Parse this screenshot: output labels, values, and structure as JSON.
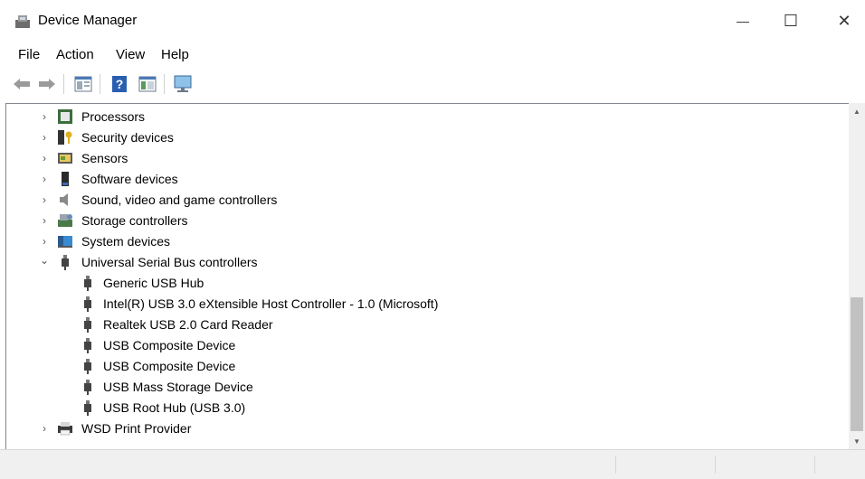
{
  "window": {
    "title": "Device Manager",
    "minimize_glyph": "—",
    "maximize_glyph": "☐",
    "close_glyph": "✕"
  },
  "menu": {
    "file": "File",
    "action": "Action",
    "view": "View",
    "help": "Help"
  },
  "toolbar": {
    "icons": [
      "back-arrow-icon",
      "forward-arrow-icon",
      "properties-icon",
      "help-icon",
      "view-icon",
      "monitor-scan-icon"
    ]
  },
  "tree": {
    "items": [
      {
        "label": "Processors",
        "expanded": false,
        "icon": "processor-icon"
      },
      {
        "label": "Security devices",
        "expanded": false,
        "icon": "security-key-icon"
      },
      {
        "label": "Sensors",
        "expanded": false,
        "icon": "sensor-icon"
      },
      {
        "label": "Software devices",
        "expanded": false,
        "icon": "software-device-icon"
      },
      {
        "label": "Sound, video and game controllers",
        "expanded": false,
        "icon": "speaker-icon"
      },
      {
        "label": "Storage controllers",
        "expanded": false,
        "icon": "storage-controller-icon"
      },
      {
        "label": "System devices",
        "expanded": false,
        "icon": "system-device-icon"
      },
      {
        "label": "Universal Serial Bus controllers",
        "expanded": true,
        "icon": "usb-plug-icon"
      },
      {
        "label": "WSD Print Provider",
        "expanded": false,
        "icon": "printer-icon"
      }
    ],
    "usb_children": [
      "Generic USB Hub",
      "Intel(R) USB 3.0 eXtensible Host Controller - 1.0 (Microsoft)",
      "Realtek USB 2.0 Card Reader",
      "USB Composite Device",
      "USB Composite Device",
      "USB Mass Storage Device",
      "USB Root Hub (USB 3.0)"
    ],
    "collapsed_glyph": "›",
    "expanded_glyph": "⌄"
  },
  "scrollbar": {
    "up_glyph": "▲",
    "down_glyph": "▼"
  }
}
